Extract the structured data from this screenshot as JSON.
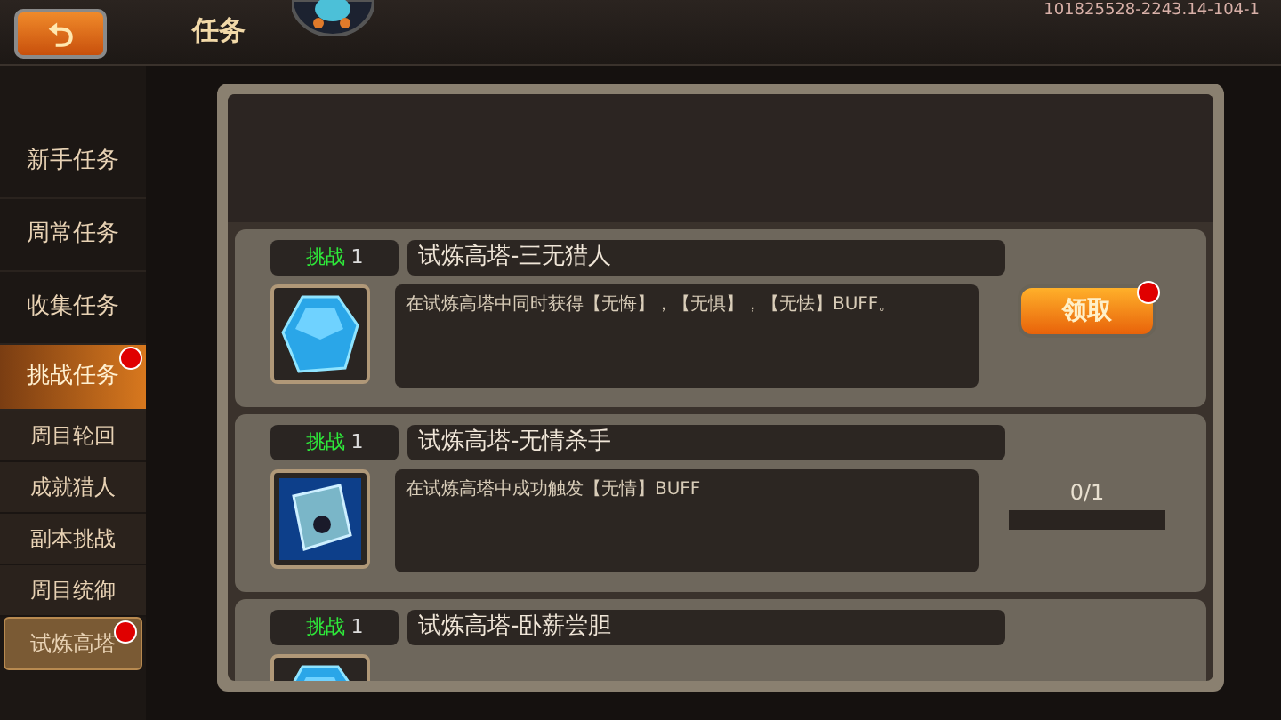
{
  "header": {
    "back_button": "⮌",
    "title": "任务",
    "build_id": "101825528-2243.14-104-1"
  },
  "sidebar": {
    "items": [
      {
        "label": "新手任务",
        "selected": false,
        "badge": false
      },
      {
        "label": "周常任务",
        "selected": false,
        "badge": false
      },
      {
        "label": "收集任务",
        "selected": false,
        "badge": false
      },
      {
        "label": "挑战任务",
        "selected": true,
        "badge": true,
        "children": [
          {
            "label": "周目轮回",
            "selected": false,
            "badge": false
          },
          {
            "label": "成就猎人",
            "selected": false,
            "badge": false
          },
          {
            "label": "副本挑战",
            "selected": false,
            "badge": false
          },
          {
            "label": "周目统御",
            "selected": false,
            "badge": false
          },
          {
            "label": "试炼高塔",
            "selected": true,
            "badge": true
          }
        ]
      }
    ]
  },
  "tasks": [
    {
      "tag": "挑战",
      "count": "1",
      "title": "试炼高塔-三无猎人",
      "description": "在试炼高塔中同时获得【无悔】，【无惧】，【无怯】BUFF。",
      "reward": {
        "kind": "claim",
        "label": "领取",
        "badge": true
      }
    },
    {
      "tag": "挑战",
      "count": "1",
      "title": "试炼高塔-无情杀手",
      "description": "在试炼高塔中成功触发【无情】BUFF",
      "reward": {
        "kind": "progress",
        "label": "0/1",
        "level": 0
      }
    },
    {
      "tag": "挑战",
      "count": "1",
      "title": "试炼高塔-卧薪尝胆"
    }
  ]
}
